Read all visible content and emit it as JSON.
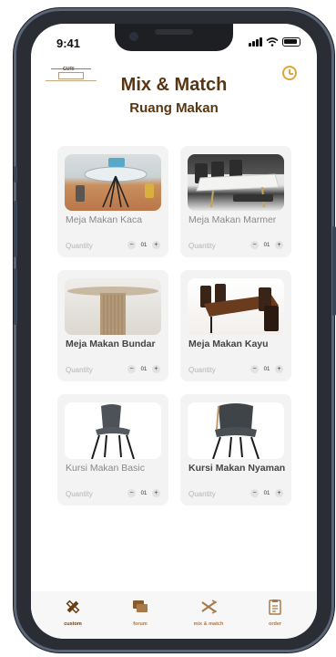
{
  "status": {
    "time": "9:41"
  },
  "header": {
    "title": "Mix & Match",
    "subtitle": "Ruang Makan",
    "logo_text": "GURI"
  },
  "products": [
    {
      "name": "Meja Makan Kaca",
      "quantity_label": "Quantity",
      "quantity": "01",
      "bold": false
    },
    {
      "name": "Meja Makan Marmer",
      "quantity_label": "Quantity",
      "quantity": "01",
      "bold": false
    },
    {
      "name": "Meja Makan Bundar",
      "quantity_label": "Quantity",
      "quantity": "01",
      "bold": true
    },
    {
      "name": "Meja Makan Kayu",
      "quantity_label": "Quantity",
      "quantity": "01",
      "bold": true
    },
    {
      "name": "Kursi Makan Basic",
      "quantity_label": "Quantity",
      "quantity": "01",
      "bold": false
    },
    {
      "name": "Kursi Makan Nyaman",
      "quantity_label": "Quantity",
      "quantity": "01",
      "bold": true
    }
  ],
  "stepper": {
    "minus": "−",
    "plus": "+"
  },
  "nav": [
    {
      "label": "custom",
      "icon": "pencil-ruler-icon"
    },
    {
      "label": "forum",
      "icon": "chat-icon"
    },
    {
      "label": "mix & match",
      "icon": "shuffle-icon"
    },
    {
      "label": "order",
      "icon": "clipboard-icon"
    }
  ],
  "colors": {
    "brand": "#5a3512",
    "accent": "#e3a43a",
    "card": "#f3f3f3"
  }
}
